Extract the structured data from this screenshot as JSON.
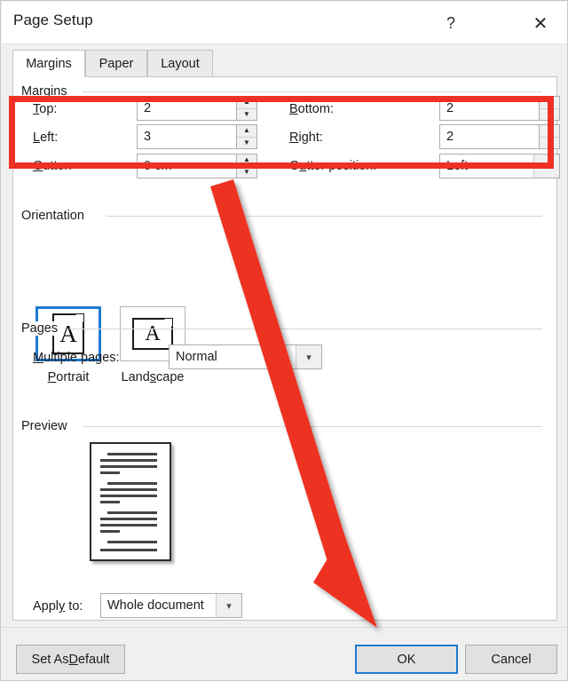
{
  "window": {
    "title": "Page Setup",
    "help_icon": "question-mark-icon",
    "close_icon": "close-x-icon",
    "help_glyph": "?",
    "close_glyph": "✕"
  },
  "tabs": [
    {
      "label": "Margins",
      "active": true
    },
    {
      "label": "Paper",
      "active": false
    },
    {
      "label": "Layout",
      "active": false
    }
  ],
  "groups": {
    "margins": {
      "label": "Margins"
    },
    "orientation": {
      "label": "Orientation"
    },
    "pages": {
      "label": "Pages"
    },
    "preview": {
      "label": "Preview"
    }
  },
  "margins": {
    "top": {
      "label": "Top:",
      "access_key": "T",
      "value": "2"
    },
    "bottom": {
      "label": "Bottom:",
      "access_key": "B",
      "value": "2"
    },
    "left": {
      "label": "Left:",
      "access_key": "L",
      "value": "3"
    },
    "right": {
      "label": "Right:",
      "access_key": "R",
      "value": "2",
      "focused": true
    },
    "gutter": {
      "label": "Gutter:",
      "access_key": "G",
      "value": "0 cm"
    },
    "gutter_position": {
      "label": "Gutter position:",
      "access_key": "u",
      "value": "Left"
    }
  },
  "orientation": {
    "portrait": {
      "label": "Portrait",
      "access_key": "P",
      "selected": true,
      "glyph": "A"
    },
    "landscape": {
      "label": "Landscape",
      "access_key": "s",
      "selected": false,
      "glyph": "A"
    }
  },
  "pages": {
    "multiple_pages": {
      "label": "Multiple pages:",
      "access_key": "M",
      "value": "Normal"
    }
  },
  "apply_to": {
    "label": "Apply to:",
    "access_key": "y",
    "value": "Whole document"
  },
  "buttons": {
    "set_as_default": {
      "label": "Set As Default",
      "access_key": "D",
      "focused": false
    },
    "ok": {
      "label": "OK",
      "focused": true
    },
    "cancel": {
      "label": "Cancel",
      "focused": false
    }
  },
  "annotations": {
    "highlight_box": {
      "name": "margins-highlight-rectangle",
      "color": "#ee3124"
    },
    "arrow": {
      "name": "pointer-arrow-to-ok-button",
      "color": "#ee3124",
      "points_to": "OK"
    }
  },
  "colors": {
    "accent_blue": "#1f7bd1",
    "annotation_red": "#ee3124",
    "dialog_bg": "#f0f0f0",
    "page_bg": "#ffffff"
  }
}
